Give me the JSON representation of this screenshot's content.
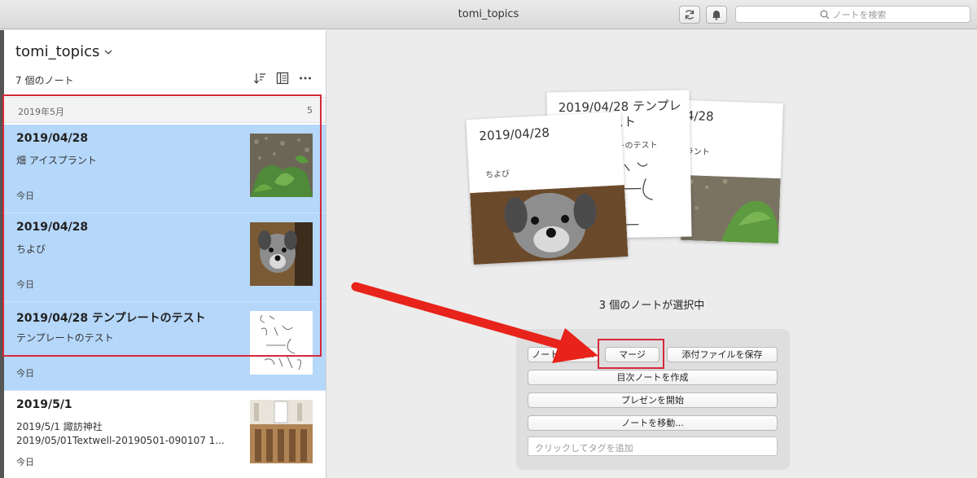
{
  "window": {
    "title": "tomi_topics"
  },
  "toolbar": {
    "search_placeholder": "ノートを検索"
  },
  "sidebar": {
    "notebook_title": "tomi_topics",
    "note_count": "7 個のノート",
    "section": {
      "label": "2019年5月",
      "count": "5"
    },
    "notes": [
      {
        "title": "2019/04/28",
        "snippet": "畑 アイスプラント",
        "date": "今日",
        "selected": true
      },
      {
        "title": "2019/04/28",
        "snippet": "ちよび",
        "date": "今日",
        "selected": true
      },
      {
        "title": "2019/04/28 テンプレートのテスト",
        "snippet": "テンプレートのテスト",
        "date": "今日",
        "selected": true
      },
      {
        "title": "2019/5/1",
        "snippet_line1": "2019/5/1 諏訪神社",
        "snippet_line2": "2019/05/01Textwell-20190501-090107 1...",
        "date": "今日",
        "selected": false
      }
    ]
  },
  "main": {
    "cards": [
      {
        "title": "2019/04/28",
        "snippet": "ちよび"
      },
      {
        "title": "2019/04/28 テンプレ ート のテスト",
        "snippet": "ートのテスト"
      },
      {
        "title": "04/28",
        "snippet": "プラント"
      }
    ],
    "selected_text": "3 個のノートが選択中",
    "actions": {
      "share": "ノートを共有...",
      "merge": "マージ",
      "save_attachments": "添付ファイルを保存",
      "create_toc": "目次ノートを作成",
      "presentation": "プレゼンを開始",
      "move": "ノートを移動...",
      "tag_placeholder": "クリックしてタグを追加"
    }
  },
  "colors": {
    "selection": "#b5d7fa",
    "highlight": "#d6283a",
    "arrow": "#e8231b"
  }
}
